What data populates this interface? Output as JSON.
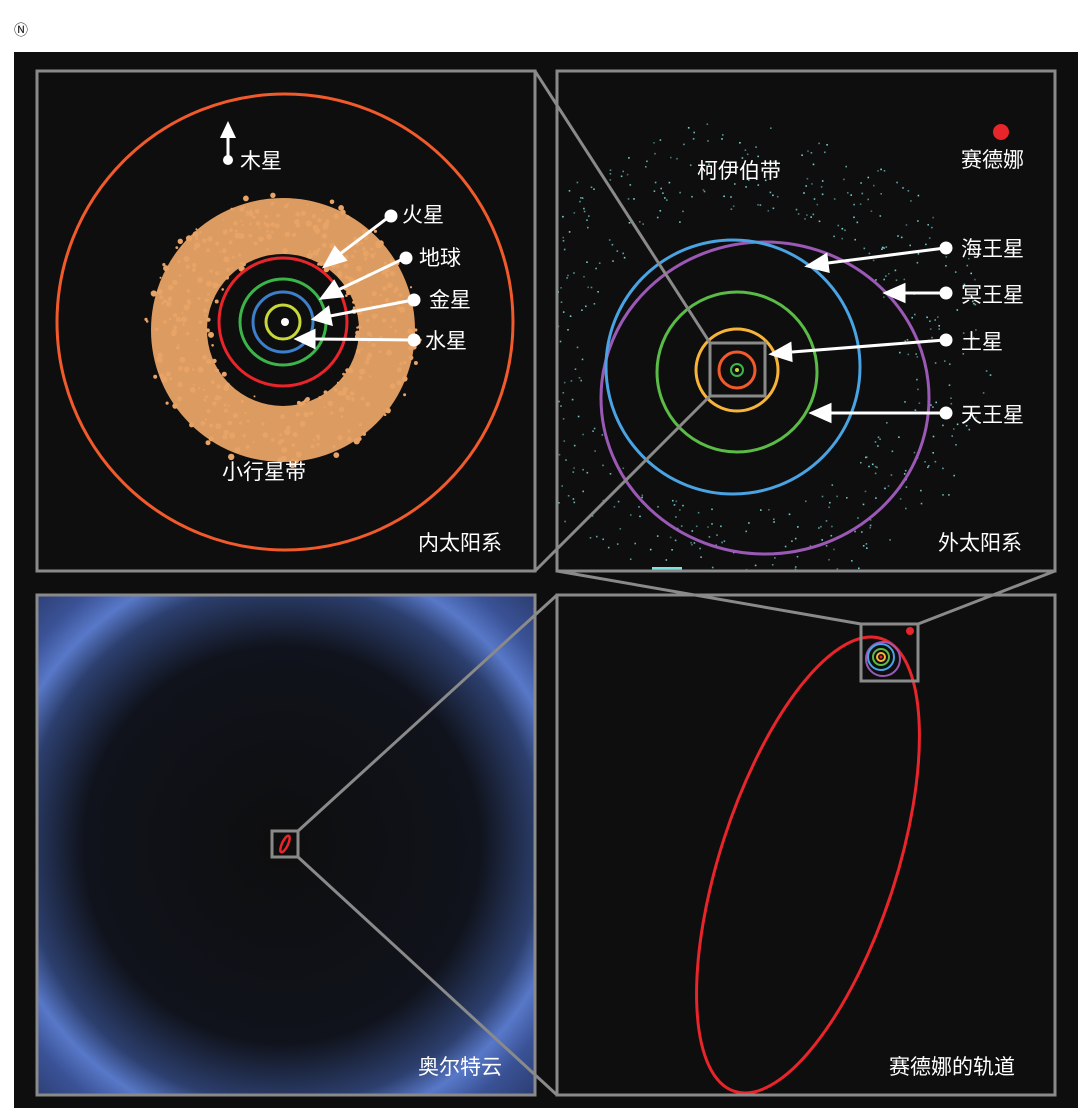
{
  "corner_mark": "Ⓝ",
  "colors": {
    "background": "#0e0e0e",
    "frame": "#8a8a8a",
    "sedna": "#e8252a",
    "mercury": "#c8d83a",
    "venus": "#3d7fc9",
    "earth": "#3bb54a",
    "mars": "#e8252a",
    "jupiter_orbit": "#f15a2b",
    "saturn_orbit": "#f7b43a",
    "uranus_orbit": "#5bbb47",
    "neptune_orbit": "#4aa3e3",
    "pluto_orbit": "#9b59b6",
    "asteroid_belt": "#e8a366",
    "kuiper_belt": "#7ee0e0",
    "oort_cloud": "#4a6fc7"
  },
  "panels": {
    "inner": {
      "caption": "内太阳系",
      "labels": {
        "jupiter": "木星",
        "mars": "火星",
        "earth": "地球",
        "venus": "金星",
        "mercury": "水星",
        "asteroid_belt": "小行星带"
      }
    },
    "outer": {
      "caption": "外太阳系",
      "labels": {
        "kuiper_belt": "柯伊伯带",
        "sedna": "赛德娜",
        "neptune": "海王星",
        "pluto": "冥王星",
        "saturn": "土星",
        "uranus": "天王星"
      }
    },
    "oort": {
      "caption": "奥尔特云"
    },
    "sedna_orbit": {
      "caption": "赛德娜的轨道"
    }
  }
}
